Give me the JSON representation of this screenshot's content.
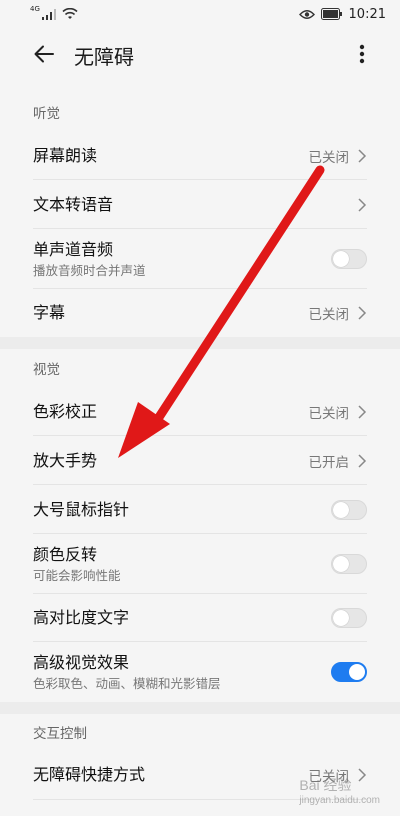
{
  "status_bar": {
    "time": "10:21",
    "signal_label": "4G"
  },
  "app_bar": {
    "title": "无障碍"
  },
  "sections": [
    {
      "header": "听觉",
      "rows": [
        {
          "title": "屏幕朗读",
          "value": "已关闭",
          "type": "link"
        },
        {
          "title": "文本转语音",
          "value": "",
          "type": "link"
        },
        {
          "title": "单声道音频",
          "subtitle": "播放音频时合并声道",
          "type": "toggle",
          "on": false
        },
        {
          "title": "字幕",
          "value": "已关闭",
          "type": "link"
        }
      ]
    },
    {
      "header": "视觉",
      "rows": [
        {
          "title": "色彩校正",
          "value": "已关闭",
          "type": "link"
        },
        {
          "title": "放大手势",
          "value": "已开启",
          "type": "link"
        },
        {
          "title": "大号鼠标指针",
          "type": "toggle",
          "on": false
        },
        {
          "title": "颜色反转",
          "subtitle": "可能会影响性能",
          "type": "toggle",
          "on": false
        },
        {
          "title": "高对比度文字",
          "type": "toggle",
          "on": false
        },
        {
          "title": "高级视觉效果",
          "subtitle": "色彩取色、动画、模糊和光影错层",
          "type": "toggle",
          "on": true
        }
      ]
    },
    {
      "header": "交互控制",
      "rows": [
        {
          "title": "无障碍快捷方式",
          "value": "已关闭",
          "type": "link"
        }
      ]
    }
  ],
  "watermark": {
    "text": "Bai 经验",
    "sub": "jingyan.baidu.com"
  },
  "colors": {
    "accent": "#1e7cf0",
    "arrow": "#e01818"
  }
}
